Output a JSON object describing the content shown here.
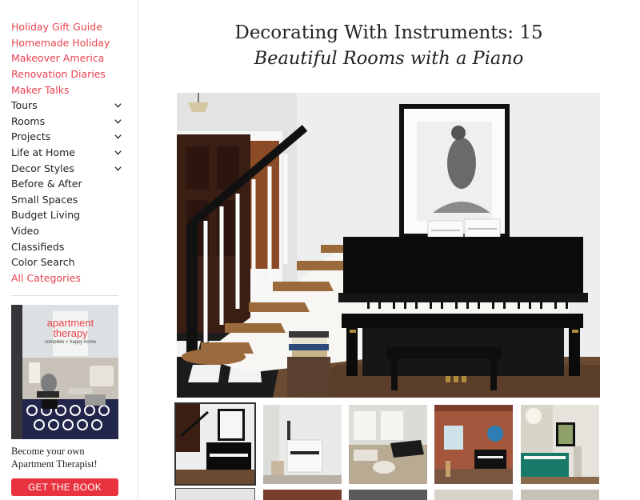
{
  "sidebar": {
    "featured": [
      "Holiday Gift Guide",
      "Homemade Holiday",
      "Makeover America",
      "Renovation Diaries",
      "Maker Talks"
    ],
    "menu": [
      {
        "label": "Tours",
        "expandable": true
      },
      {
        "label": "Rooms",
        "expandable": true
      },
      {
        "label": "Projects",
        "expandable": true
      },
      {
        "label": "Life at Home",
        "expandable": true
      },
      {
        "label": "Decor Styles",
        "expandable": true
      },
      {
        "label": "Before & After",
        "expandable": false
      },
      {
        "label": "Small Spaces",
        "expandable": false
      },
      {
        "label": "Budget Living",
        "expandable": false
      },
      {
        "label": "Video",
        "expandable": false
      },
      {
        "label": "Classifieds",
        "expandable": false
      },
      {
        "label": "Color Search",
        "expandable": false
      }
    ],
    "all_categories": "All Categories",
    "book": {
      "title_line1": "apartment",
      "title_line2": "therapy",
      "subtitle": "complete + happy home"
    },
    "promo_text": "Become your own Apartment Therapist!",
    "cta_label": "GET THE BOOK"
  },
  "article": {
    "title_line1": "Decorating With Instruments: 15",
    "title_line2": "Beautiful Rooms with a Piano"
  },
  "gallery": {
    "thumbnails": [
      {
        "name": "piano-room",
        "selected": true
      },
      {
        "name": "white-piano",
        "selected": false
      },
      {
        "name": "living-grand-piano",
        "selected": false
      },
      {
        "name": "brick-loft",
        "selected": false
      },
      {
        "name": "green-piano",
        "selected": false
      }
    ]
  },
  "colors": {
    "accent": "#e8434f",
    "cta": "#e8333f",
    "text": "#222222"
  }
}
